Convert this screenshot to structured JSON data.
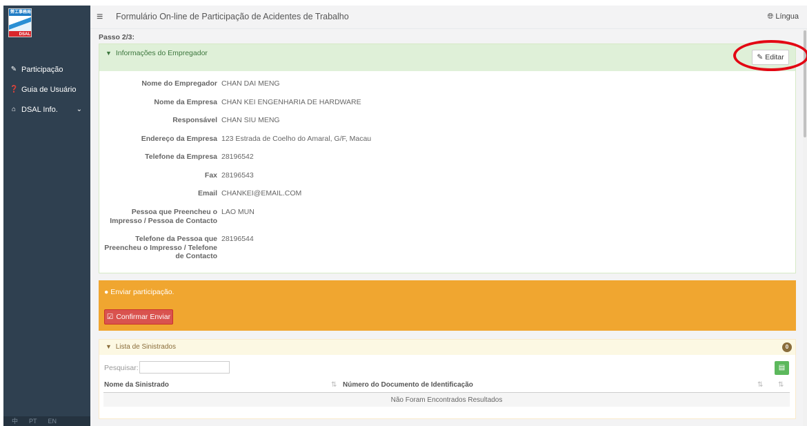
{
  "sidebar": {
    "logo": {
      "top_text": "勞工事務局",
      "bottom_text": "DSAL"
    },
    "items": [
      {
        "icon": "edit-icon",
        "label": "Participação"
      },
      {
        "icon": "question-circle-icon",
        "label": "Guia de Usuário"
      },
      {
        "icon": "home-icon",
        "label": "DSAL Info."
      }
    ],
    "languages": [
      "中",
      "PT",
      "EN"
    ]
  },
  "header": {
    "title": "Formulário On-line de Participação de Acidentes de Trabalho",
    "language_label": "Língua"
  },
  "main": {
    "step": "Passo 2/3:",
    "employer_panel": {
      "title": "Informações do Empregador",
      "edit_label": "Editar",
      "fields": [
        {
          "label": "Nome do Empregador",
          "value": "CHAN DAI MENG"
        },
        {
          "label": "Nome da Empresa",
          "value": "CHAN KEI ENGENHARIA DE HARDWARE"
        },
        {
          "label": "Responsável",
          "value": "CHAN SIU MENG"
        },
        {
          "label": "Endereço da Empresa",
          "value": "123 Estrada de Coelho do Amaral, G/F, Macau"
        },
        {
          "label": "Telefone da Empresa",
          "value": "28196542"
        },
        {
          "label": "Fax",
          "value": "28196543"
        },
        {
          "label": "Email",
          "value": "CHANKEI@EMAIL.COM"
        },
        {
          "label": "Pessoa que Preencheu o Impresso / Pessoa de Contacto",
          "value": "LAO MUN"
        },
        {
          "label": "Telefone da Pessoa que Preencheu o Impresso / Telefone de Contacto",
          "value": "28196544"
        }
      ]
    },
    "submit_panel": {
      "message": "Enviar participação.",
      "confirm_label": "Confirmar Enviar"
    },
    "victims_panel": {
      "title": "Lista de Sinistrados",
      "count": "0",
      "search_label": "Pesquisar:",
      "search_value": "",
      "columns": [
        "Nome da Sinistrado",
        "Número do Documento de Identificação"
      ],
      "empty_message": "Não Foram Encontrados Resultados"
    }
  },
  "colors": {
    "sidebar": "#2f4050",
    "employer_header": "#dff0d8",
    "warning_panel": "#f0a630",
    "confirm_button": "#d9534f",
    "highlight_ring": "#e30613"
  }
}
